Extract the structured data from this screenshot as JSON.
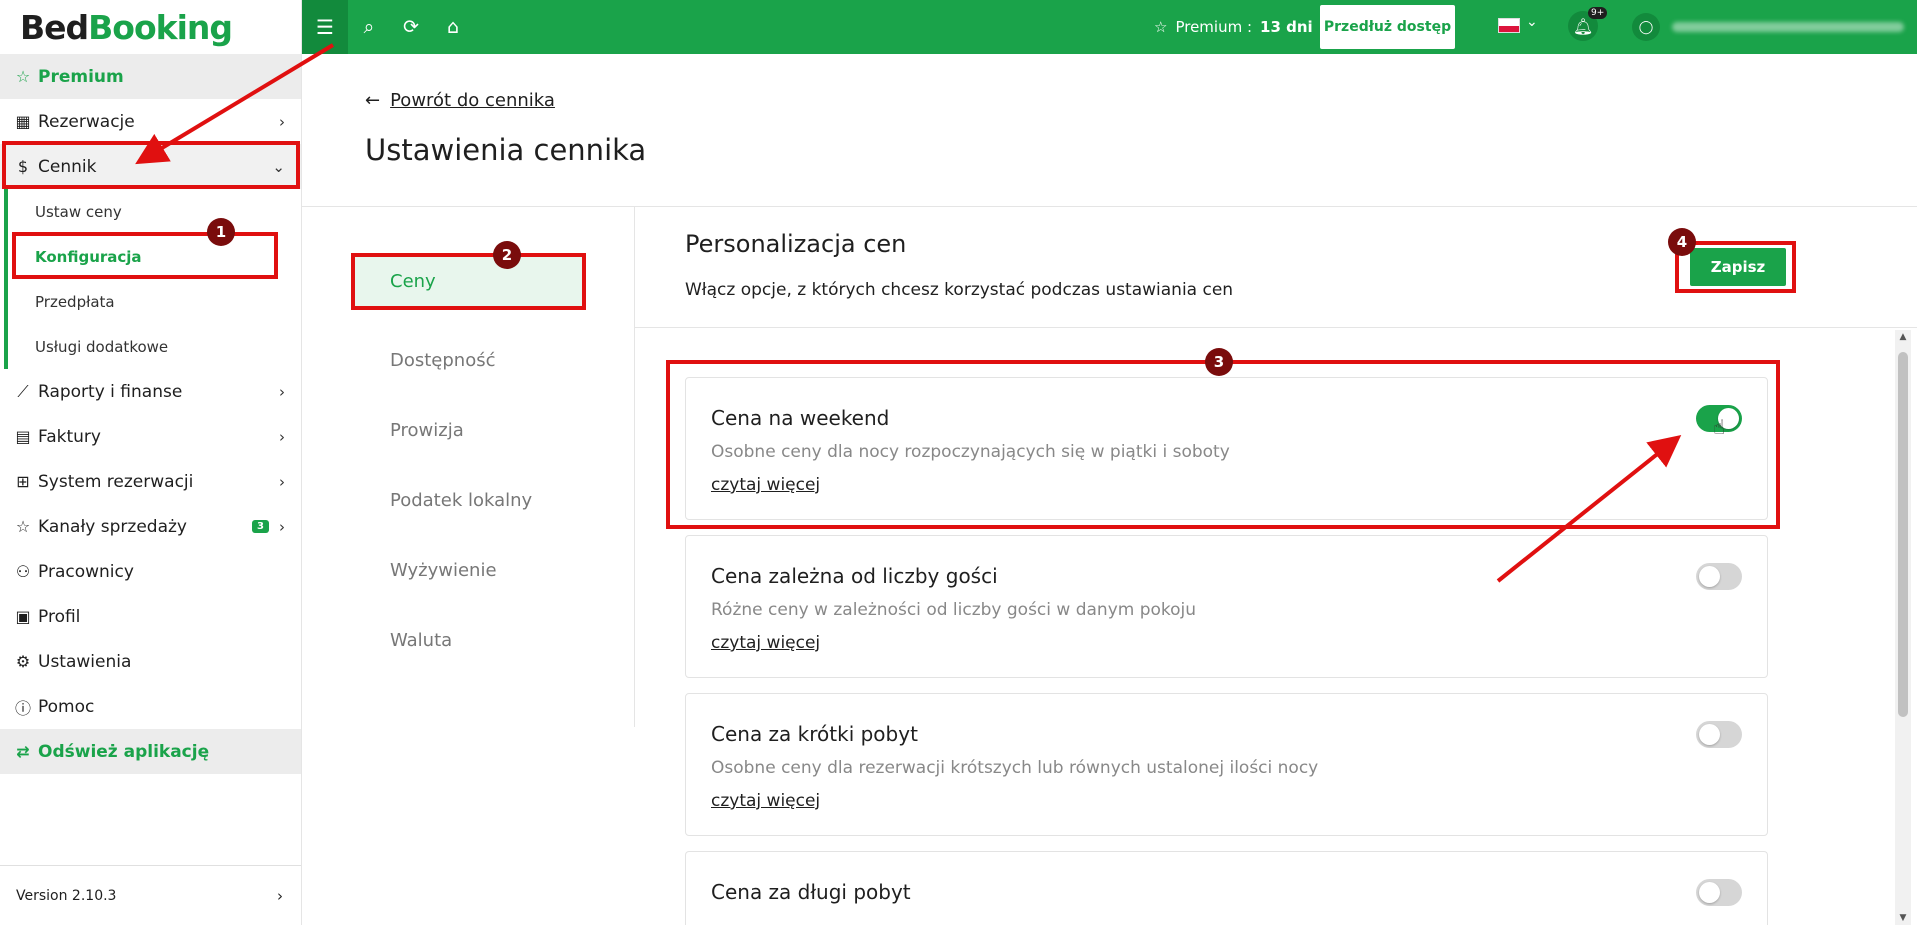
{
  "brand": {
    "part1": "Bed",
    "part2": "Booking"
  },
  "sidebar": {
    "premium": "Premium",
    "items": [
      {
        "label": "Rezerwacje",
        "icon": "calendar-icon"
      },
      {
        "label": "Cennik",
        "icon": "dollar-icon"
      },
      {
        "label": "Raporty i finanse",
        "icon": "chart-icon"
      },
      {
        "label": "Faktury",
        "icon": "invoice-icon"
      },
      {
        "label": "System rezerwacji",
        "icon": "grid-icon"
      },
      {
        "label": "Kanały sprzedaży",
        "icon": "star-icon",
        "badge": "3"
      },
      {
        "label": "Pracownicy",
        "icon": "user-plus-icon"
      },
      {
        "label": "Profil",
        "icon": "briefcase-icon"
      },
      {
        "label": "Ustawienia",
        "icon": "gear-icon"
      },
      {
        "label": "Pomoc",
        "icon": "info-icon"
      }
    ],
    "submenu": [
      "Ustaw ceny",
      "Konfiguracja",
      "Przedpłata",
      "Usługi dodatkowe"
    ],
    "refresh": "Odśwież aplikację",
    "version": "Version 2.10.3"
  },
  "topbar": {
    "premium_label": "Premium :",
    "premium_days": "13 dni",
    "extend_button": "Przedłuż dostęp",
    "notifications": "9+"
  },
  "header": {
    "back_link": "Powrót do cennika",
    "title": "Ustawienia cennika"
  },
  "tabs": [
    "Ceny",
    "Dostępność",
    "Prowizja",
    "Podatek lokalny",
    "Wyżywienie",
    "Waluta"
  ],
  "content": {
    "title": "Personalizacja cen",
    "subtitle": "Włącz opcje, z których chcesz korzystać podczas ustawiania cen",
    "save_button": "Zapisz",
    "cards": [
      {
        "title": "Cena na weekend",
        "desc": "Osobne ceny dla nocy rozpoczynających się w piątki i soboty",
        "link": "czytaj więcej",
        "enabled": true
      },
      {
        "title": "Cena zależna od liczby gości",
        "desc": "Różne ceny w zależności od liczby gości w danym pokoju",
        "link": "czytaj więcej",
        "enabled": false
      },
      {
        "title": "Cena za krótki pobyt",
        "desc": "Osobne ceny dla rezerwacji krótszych lub równych ustalonej ilości nocy",
        "link": "czytaj więcej",
        "enabled": false
      },
      {
        "title": "Cena za długi pobyt",
        "desc": "",
        "link": "",
        "enabled": false
      }
    ]
  },
  "annotations": [
    "1",
    "2",
    "3",
    "4"
  ],
  "colors": {
    "brand_green": "#1aa34a",
    "annotation_red": "#e01010",
    "badge_dark_red": "#7a0c0c"
  }
}
